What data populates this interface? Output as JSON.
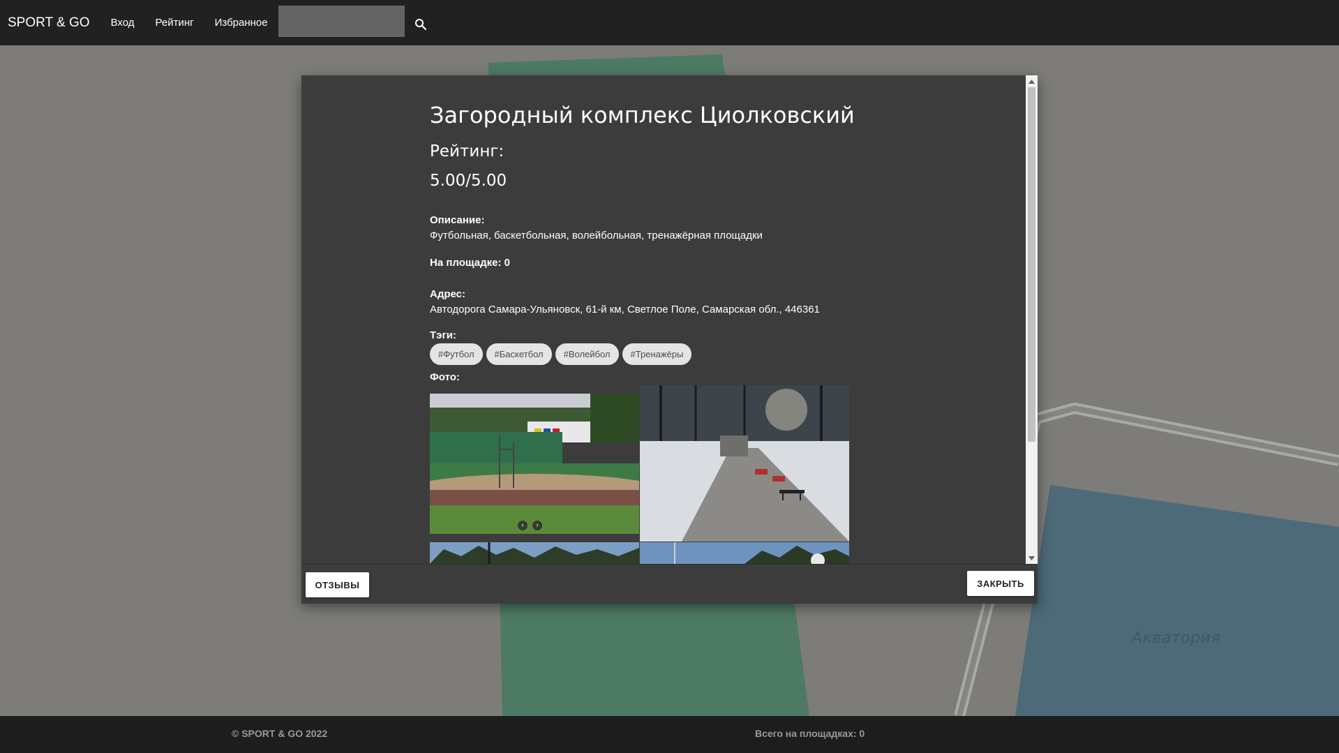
{
  "navbar": {
    "brand": "SPORT & GO",
    "links": {
      "login": "Вход",
      "rating": "Рейтинг",
      "favorites": "Избранное"
    },
    "search": {
      "value": "",
      "placeholder": ""
    },
    "search_icon": "search-icon"
  },
  "map": {
    "label": "Акватория"
  },
  "modal": {
    "title": "Загородный комплекс Циолковский",
    "rating_label": "Рейтинг:",
    "rating_value": "5.00/5.00",
    "description_label": "Описание:",
    "description": "Футбольная, баскетбольная, волейбольная, тренажёрная площадки",
    "onsite": "На площадке: 0",
    "address_label": "Адрес:",
    "address": "Автодорога Самара-Ульяновск, 61-й км, Светлое Поле, Самарская обл., 446361",
    "tags_label": "Тэги:",
    "tags": [
      "#Футбол",
      "#Баскетбол",
      "#Волейбол",
      "#Тренажёры"
    ],
    "photos_label": "Фото:",
    "carousel": {
      "prev": "‹",
      "next": "›"
    },
    "buttons": {
      "reviews": "ОТЗЫВЫ",
      "close": "ЗАКРЫТЬ"
    }
  },
  "footer": {
    "copyright": "© SPORT & GO 2022",
    "total": "Всего на площадках: 0"
  },
  "colors": {
    "navbar_bg": "#212121",
    "modal_bg": "#3c3c3c",
    "map_bg": "#7d7c78",
    "footer_bg": "#1d1d1d",
    "tag_bg": "#e4e4e4"
  }
}
